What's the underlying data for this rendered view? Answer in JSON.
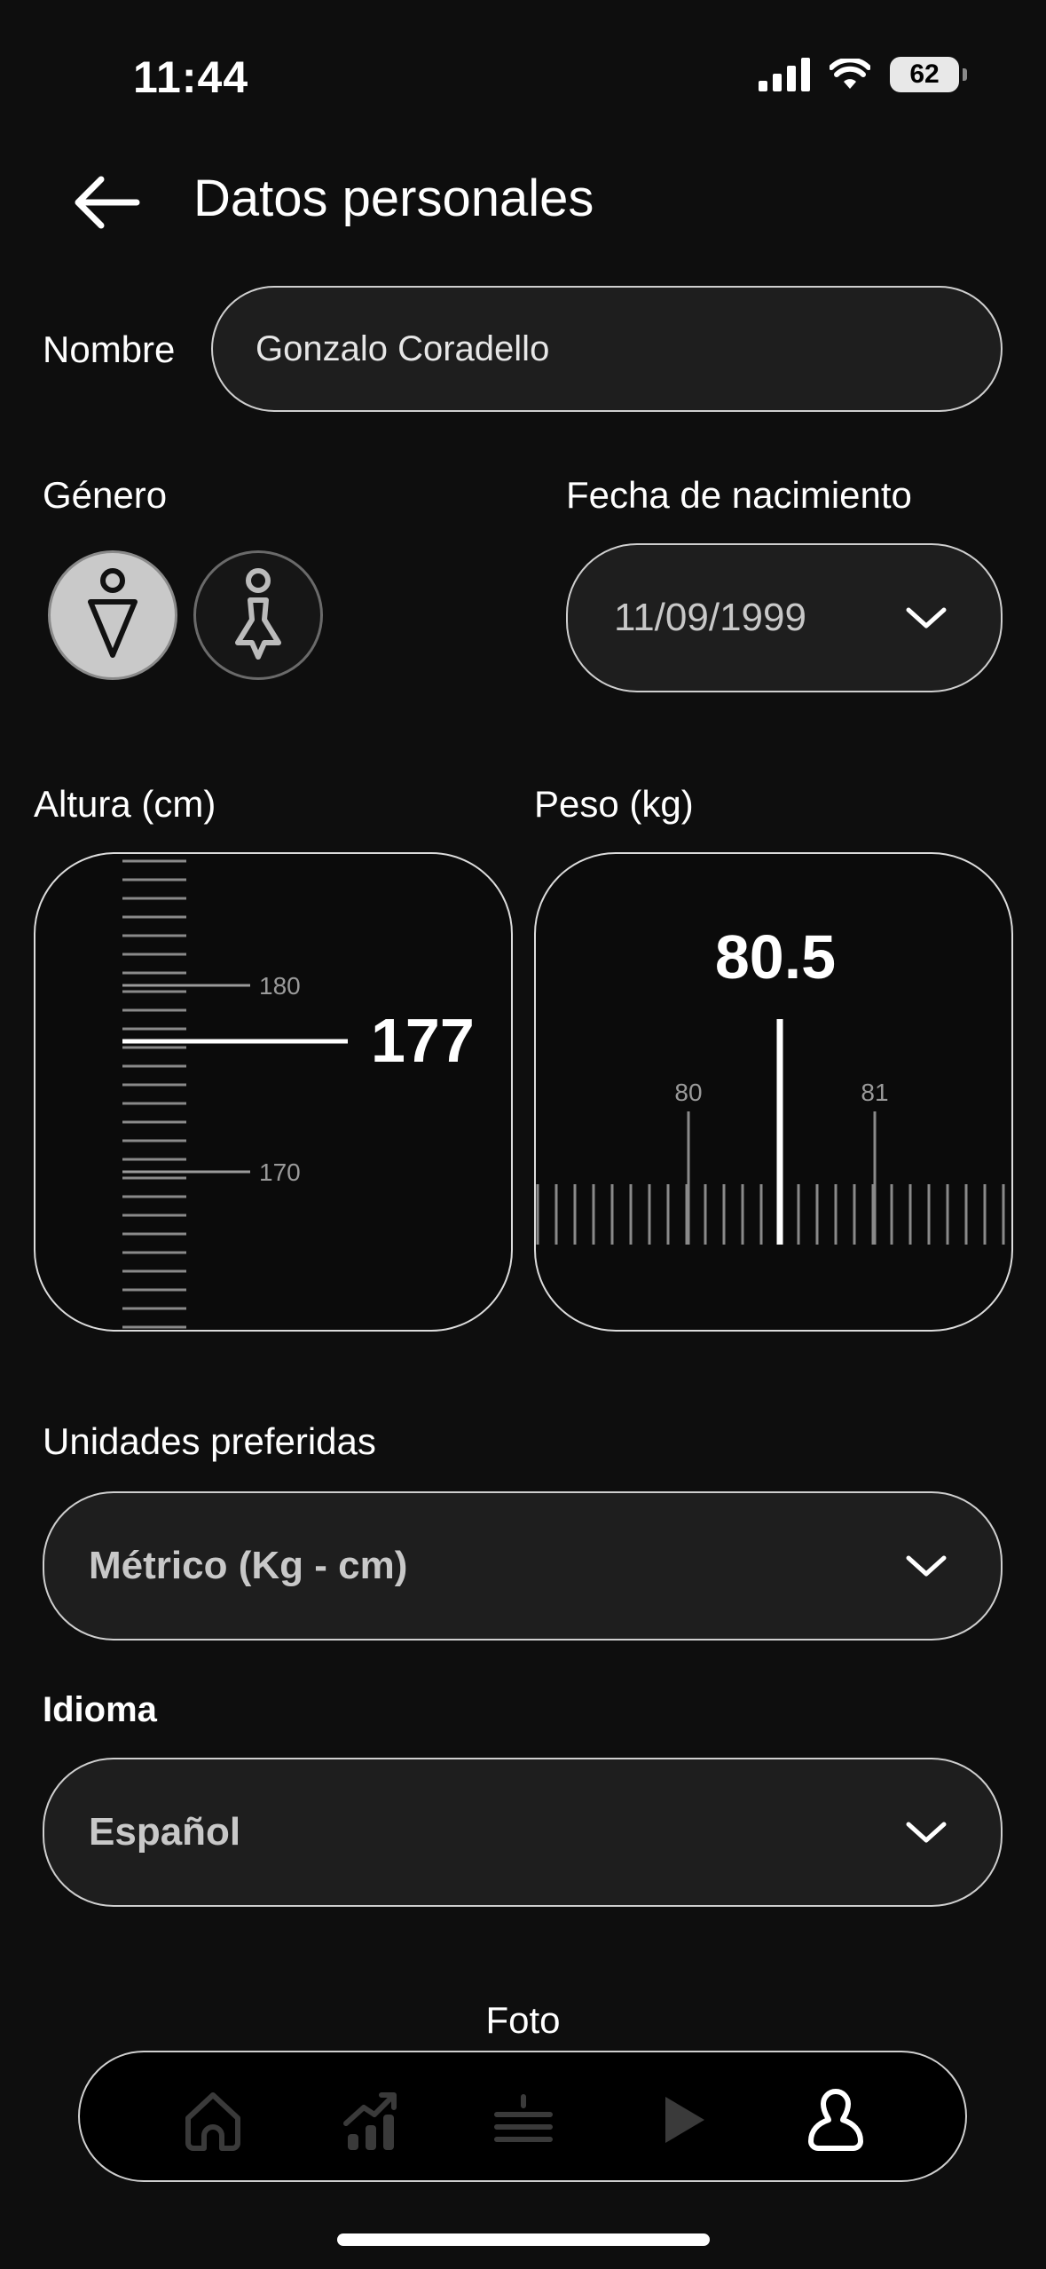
{
  "status": {
    "time": "11:44",
    "battery": "62"
  },
  "header": {
    "title": "Datos personales",
    "back_icon": "arrow-left-icon"
  },
  "form": {
    "name_label": "Nombre",
    "name_value": "Gonzalo Coradello",
    "gender_label": "Género",
    "gender_selected": "male",
    "birthdate_label": "Fecha de nacimiento",
    "birthdate_value": "11/09/1999",
    "height_label": "Altura (cm)",
    "height_value": "177",
    "height_ticks": [
      "180",
      "170"
    ],
    "weight_label": "Peso (kg)",
    "weight_value": "80.5",
    "weight_ticks": [
      "80",
      "81"
    ],
    "units_label": "Unidades preferidas",
    "units_value": "Métrico (Kg - cm)",
    "language_label": "Idioma",
    "language_value": "Español",
    "photo_label": "Foto"
  },
  "tabbar": {
    "items": [
      {
        "name": "home",
        "icon": "home-icon"
      },
      {
        "name": "progress",
        "icon": "chart-up-icon"
      },
      {
        "name": "routines",
        "icon": "list-icon"
      },
      {
        "name": "play",
        "icon": "play-icon"
      },
      {
        "name": "profile",
        "icon": "user-icon",
        "active": true
      }
    ]
  },
  "colors": {
    "background": "#0e0e0e",
    "field": "#1e1e1e",
    "border": "#cfcfcf",
    "selected_gender": "#c9c9c9"
  }
}
